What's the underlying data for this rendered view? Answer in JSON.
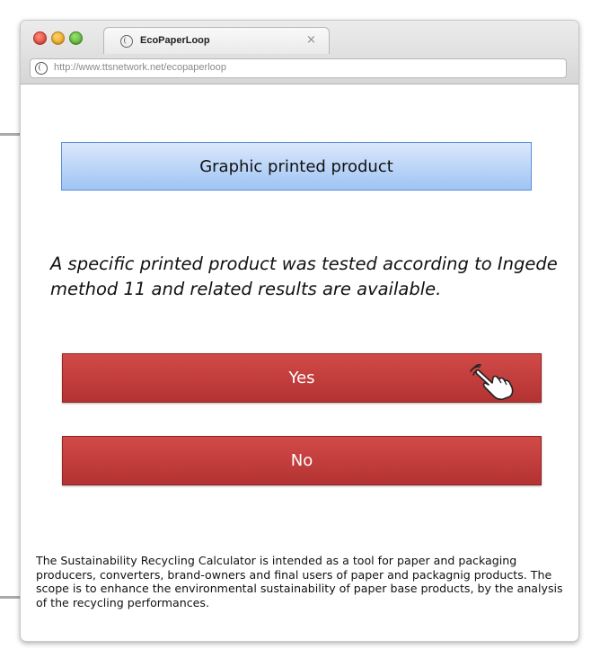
{
  "browser": {
    "tab_title": "EcoPaperLoop",
    "tab_close": "×",
    "url": "http://www.ttsnetwork.net/ecopaperloop"
  },
  "page": {
    "header": "Graphic printed product",
    "question": "A specific printed product was tested according to Ingede method 11 and related results are available.",
    "yes_label": "Yes",
    "no_label": "No",
    "footer": "The Sustainability Recycling Calculator is intended as a tool for paper and packaging producers, converters, brand-owners and final users of paper and packagnig products. The scope is to enhance the environmental sustainability of paper base products, by the analysis of the recycling performances."
  },
  "icons": {
    "tab": "globe-icon",
    "address": "globe-icon",
    "cursor": "pointing-hand-icon"
  },
  "colors": {
    "button_red": "#c23c3b",
    "header_blue": "#b6d2f7",
    "header_border": "#5a8fd6"
  }
}
